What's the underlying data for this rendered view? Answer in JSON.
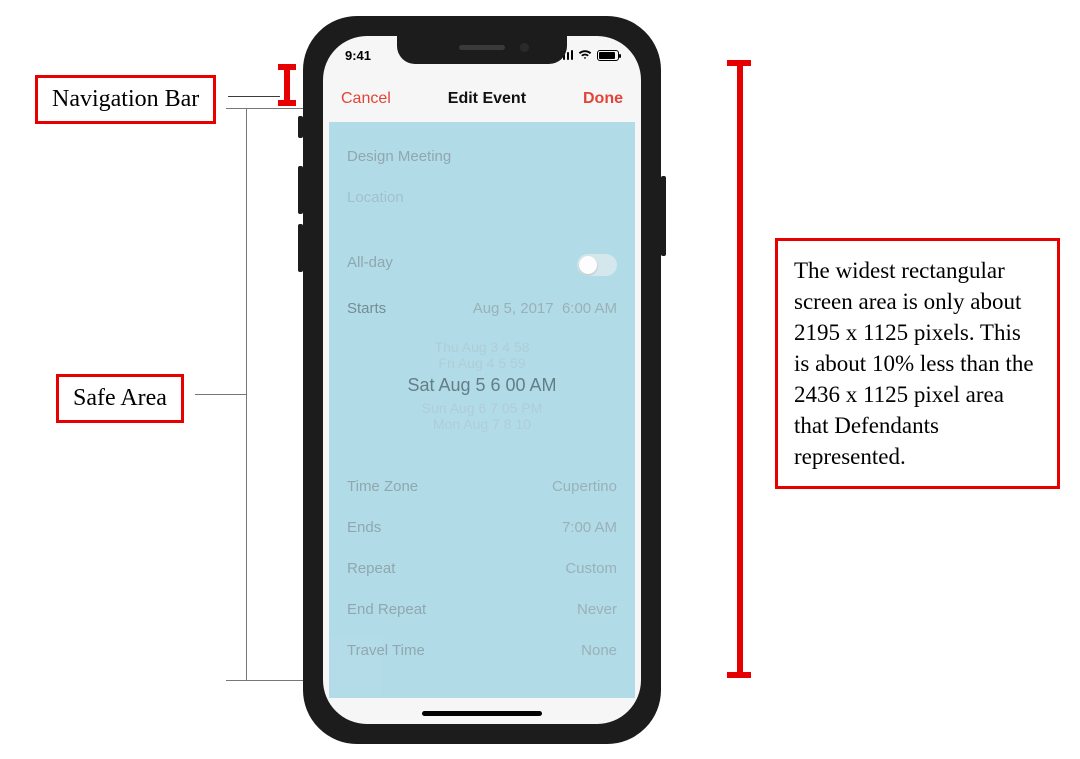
{
  "annotations": {
    "nav_bar_label": "Navigation Bar",
    "safe_area_label": "Safe Area",
    "right_text": "The widest rectangular screen area is only about 2195 x 1125 pixels. This is about 10% less than the 2436 x 1125 pixel area that Defendants represented."
  },
  "status_bar": {
    "time": "9:41"
  },
  "nav": {
    "left": "Cancel",
    "title": "Edit Event",
    "right": "Done"
  },
  "form": {
    "title_value": "Design Meeting",
    "location_placeholder": "Location",
    "all_day_label": "All-day",
    "starts_label": "Starts",
    "starts_date": "Aug 5, 2017",
    "starts_time": "6:00 AM",
    "picker": {
      "r1": "Thu Aug 3    4   58",
      "r2": "Fri Aug 4    5   59",
      "sel": "Sat Aug 5    6   00   AM",
      "r4": "Sun Aug 6    7   05   PM",
      "r5": "Mon Aug 7    8   10"
    },
    "time_zone_label": "Time Zone",
    "time_zone_value": "Cupertino",
    "ends_label": "Ends",
    "ends_value": "7:00 AM",
    "repeat_label": "Repeat",
    "repeat_value": "Custom",
    "end_repeat_label": "End Repeat",
    "end_repeat_value": "Never",
    "travel_time_label": "Travel Time",
    "travel_time_value": "None"
  }
}
